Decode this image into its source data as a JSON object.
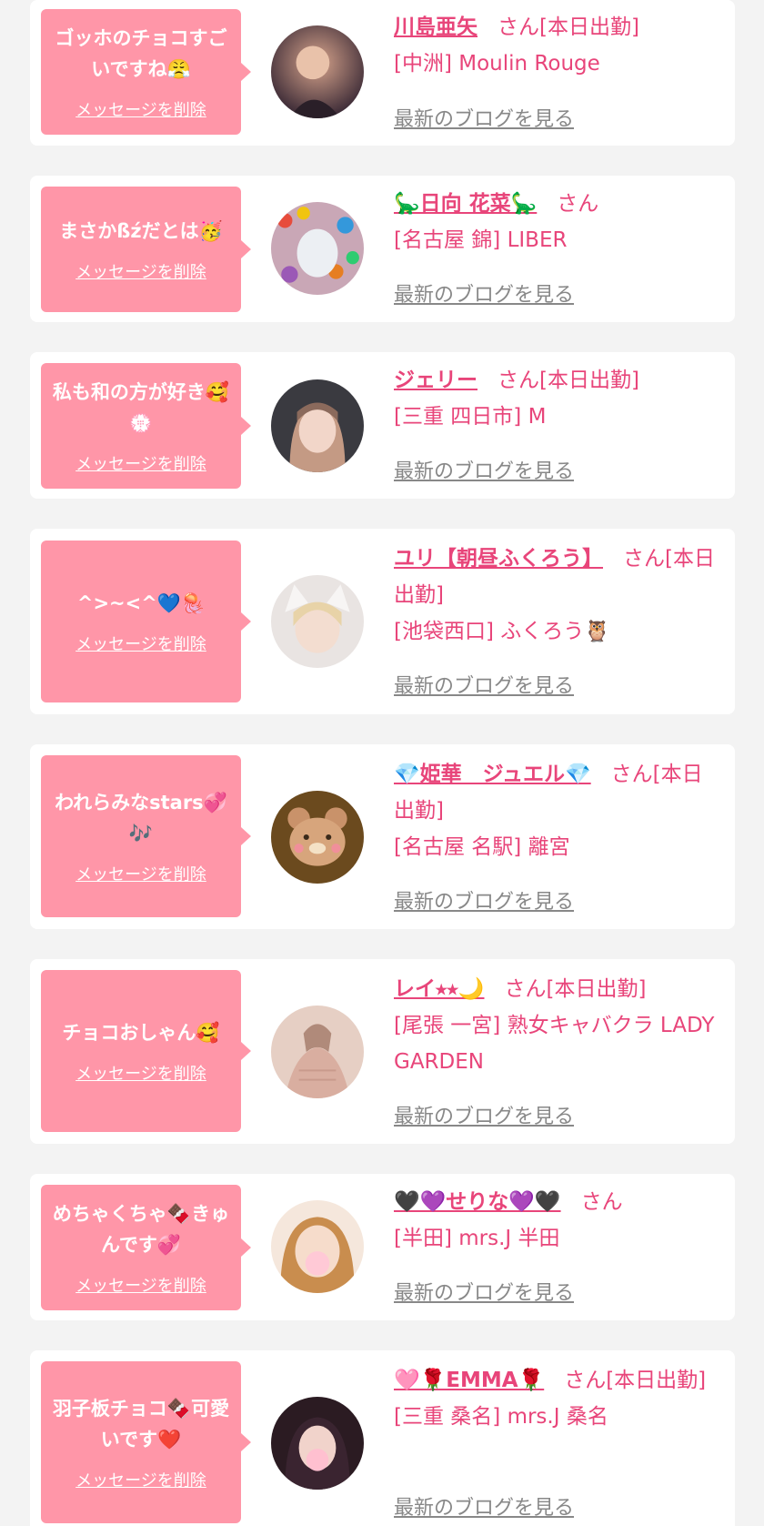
{
  "delete_label": "メッセージを削除",
  "blog_label": "最新のブログを見る",
  "san_suffix": "さん",
  "colors": {
    "bubble": "#ff96a8",
    "accent": "#e8457a",
    "link_gray": "#888888",
    "background": "#f3f3f3"
  },
  "entries": [
    {
      "message": "ゴッホのチョコすごいですね😤",
      "name": "川島亜矢",
      "status": "[本日出勤]",
      "shop": "[中洲] Moulin Rouge"
    },
    {
      "message": "まさかßźだとは🥳",
      "name": "🦕日向 花菜🦕",
      "status": "",
      "shop": "[名古屋 錦] LIBER"
    },
    {
      "message": "私も和の方が好き🥰💮",
      "name": "ジェリー",
      "status": "[本日出勤]",
      "shop": "[三重 四日市] M"
    },
    {
      "message": "^>~<^💙🪼",
      "name": "ユリ【朝昼ふくろう】",
      "status": "[本日出勤]",
      "shop": "[池袋西口] ふくろう🦉"
    },
    {
      "message": "われらみなstars💞🎶",
      "name": "💎姫華　ジュエル💎",
      "status": "[本日出勤]",
      "shop": "[名古屋 名駅] 離宮"
    },
    {
      "message": "チョコおしゃん🥰",
      "name": "レイ⭑⭑🌙",
      "status": "[本日出勤]",
      "shop": "[尾張 一宮] 熟女キャバクラ LADY GARDEN"
    },
    {
      "message": "めちゃくちゃ🍫きゅんです💞",
      "name": "🖤💜せりな💜🖤",
      "status": "",
      "shop": "[半田] mrs.J 半田"
    },
    {
      "message": "羽子板チョコ🍫可愛いです❤️",
      "name": "🩷🌹EMMA🌹",
      "status": "[本日出勤]",
      "shop": "[三重 桑名] mrs.J 桑名"
    }
  ]
}
